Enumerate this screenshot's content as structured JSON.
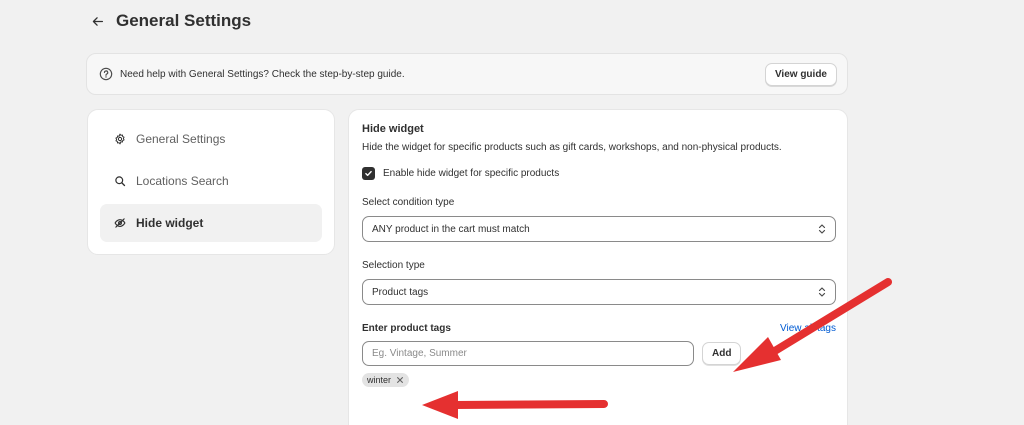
{
  "header": {
    "title": "General Settings"
  },
  "banner": {
    "text": "Need help with General Settings? Check the step-by-step guide.",
    "button_label": "View guide"
  },
  "sidebar": {
    "items": [
      {
        "label": "General Settings",
        "icon": "gear-icon",
        "active": false
      },
      {
        "label": "Locations Search",
        "icon": "search-icon",
        "active": false
      },
      {
        "label": "Hide widget",
        "icon": "eye-off-icon",
        "active": true
      }
    ]
  },
  "card": {
    "title": "Hide widget",
    "description": "Hide the widget for specific products such as gift cards, workshops, and non-physical products.",
    "checkbox_label": "Enable hide widget for specific products",
    "checkbox_checked": true,
    "condition_label": "Select condition type",
    "condition_value": "ANY product in the cart must match",
    "selection_label": "Selection type",
    "selection_value": "Product tags",
    "tags_label": "Enter product tags",
    "view_all_link": "View all tags",
    "tags_placeholder": "Eg. Vintage, Summer",
    "add_button": "Add",
    "tags": [
      "winter"
    ]
  },
  "colors": {
    "page_bg": "#f1f1f1",
    "text": "#303030",
    "link": "#005bd3",
    "annotation": "#e53030"
  }
}
